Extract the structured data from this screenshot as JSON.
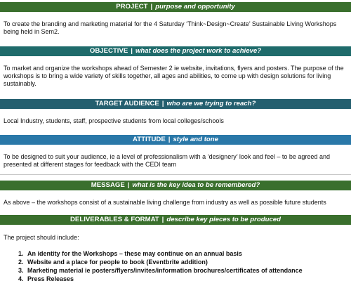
{
  "colors": {
    "project_bar": "#3a6f2d",
    "objective_bar": "#1f6b6b",
    "audience_bar": "#245f6f",
    "attitude_bar": "#2a78a8",
    "message_bar": "#3a6f2d",
    "deliverables_bar": "#3a6f2d"
  },
  "sections": {
    "project": {
      "title": "PROJECT",
      "separator": "|",
      "subtitle": "purpose and opportunity",
      "body": "To create the branding and marketing material for the 4 Saturday ‘Think~Design~Create’ Sustainable Living Workshops being held in Sem2."
    },
    "objective": {
      "title": "OBJECTIVE",
      "separator": "|",
      "subtitle": "what does the project work to achieve?",
      "body": "To market and organize the workshops ahead of Semester 2 ie website, invitations, flyers and posters. The purpose of the workshops is to bring a wide variety of skills together, all ages and abilities, to come up with design solutions for living sustainably."
    },
    "audience": {
      "title": "TARGET AUDIENCE",
      "separator": "|",
      "subtitle": "who are we trying to reach?",
      "body": "Local Industry, students, staff, prospective students from local colleges/schools"
    },
    "attitude": {
      "title": "ATTITUDE",
      "separator": "|",
      "subtitle": "style and tone",
      "body": "To be designed to suit your audience, ie a level of professionalism with a ‘designery’ look and feel – to be agreed and presented at different stages for feedback with the CEDI team"
    },
    "message": {
      "title": "MESSAGE",
      "separator": "|",
      "subtitle": "what is the key idea to be remembered?",
      "body": "As above – the workshops consist of a sustainable living challenge from industry as well as possible future students"
    },
    "deliverables": {
      "title": "DELIVERABLES & FORMAT",
      "separator": "|",
      "subtitle": "describe key pieces to be produced",
      "intro": "The project should include:",
      "items": [
        "An identity for the Workshops – these may continue on an annual basis",
        "Website and a place for people to book (Eventbrite addition)",
        "Marketing material ie posters/flyers/invites/information brochures/certificates of attendance",
        "Press Releases"
      ]
    }
  }
}
